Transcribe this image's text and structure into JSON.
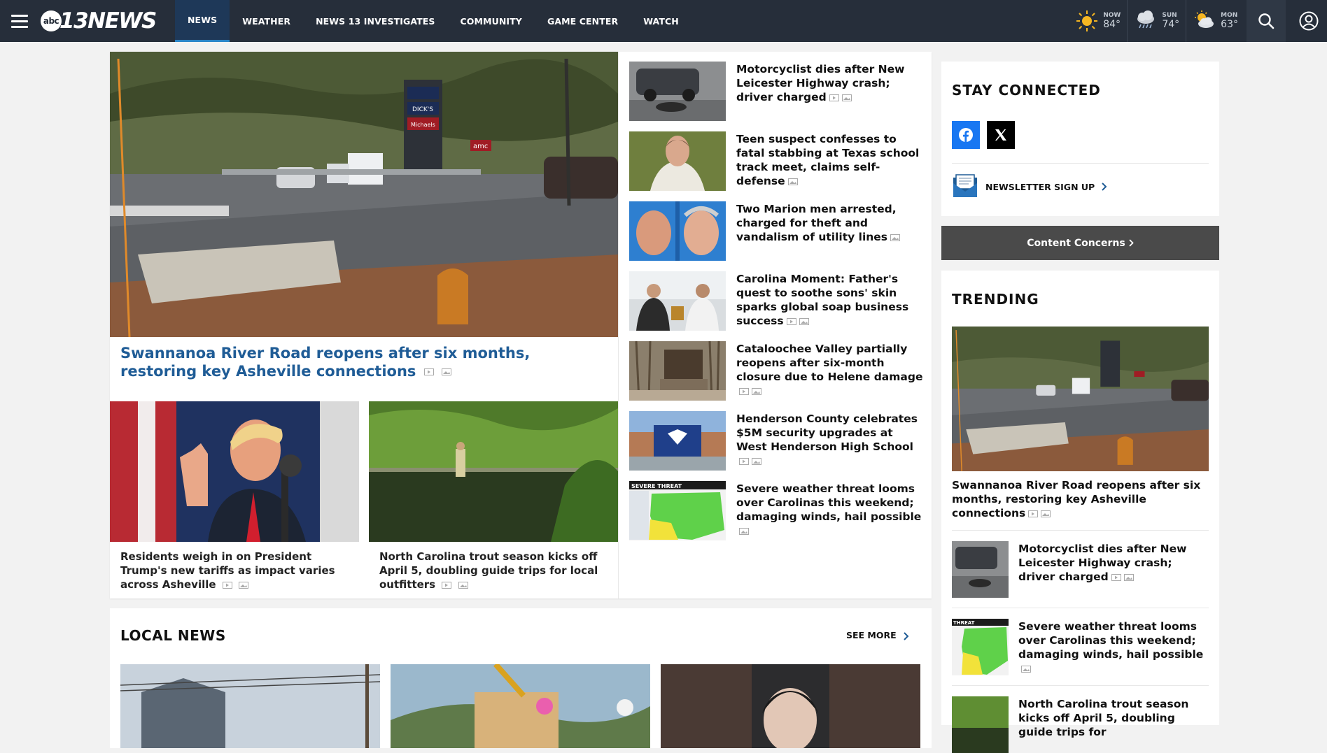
{
  "nav": {
    "brand": "13NEWS",
    "brand_prefix": "abc",
    "links": [
      "NEWS",
      "WEATHER",
      "NEWS 13 INVESTIGATES",
      "COMMUNITY",
      "GAME CENTER",
      "WATCH"
    ],
    "active": "NEWS"
  },
  "weather": [
    {
      "day": "NOW",
      "temp": "84°",
      "icon": "sun-icon"
    },
    {
      "day": "SUN",
      "temp": "74°",
      "icon": "rain-cloud-icon"
    },
    {
      "day": "MON",
      "temp": "63°",
      "icon": "partly-cloudy-icon"
    }
  ],
  "hero": {
    "title": "Swannanoa River Road reopens after six months, restoring key Asheville connections"
  },
  "sub_stories": [
    {
      "title": "Residents weigh in on President Trump's new tariffs as impact varies across Asheville"
    },
    {
      "title": "North Carolina trout season kicks off April 5, doubling guide trips for local outfitters"
    }
  ],
  "headlines": [
    {
      "title": "Motorcyclist dies after New Leicester Highway crash; driver charged",
      "video": true
    },
    {
      "title": "Teen suspect confesses to fatal stabbing at Texas school track meet, claims self-defense",
      "video": false
    },
    {
      "title": "Two Marion men arrested, charged for theft and vandalism of utility lines",
      "video": false
    },
    {
      "title": "Carolina Moment: Father's quest to soothe sons' skin sparks global soap business success",
      "video": true
    },
    {
      "title": "Cataloochee Valley partially reopens after six-month closure due to Helene damage",
      "video": true
    },
    {
      "title": "Henderson County celebrates $5M security upgrades at West Henderson High School",
      "video": true
    },
    {
      "title": "Severe weather threat looms over Carolinas this weekend; damaging winds, hail possible",
      "video": false
    }
  ],
  "thumb_text": {
    "severe": "SEVERE THREAT",
    "threat": "THREAT",
    "amc": "amc",
    "store1": "DICK'S",
    "store2": "Michaels"
  },
  "local": {
    "heading": "LOCAL NEWS",
    "see_more": "SEE MORE"
  },
  "stay_connected": {
    "heading": "STAY CONNECTED",
    "newsletter": "NEWSLETTER SIGN UP"
  },
  "content_concerns": "Content Concerns",
  "trending": {
    "heading": "TRENDING",
    "hero_caption": "Swannanoa River Road reopens after six months, restoring key Asheville connections",
    "items": [
      {
        "title": "Motorcyclist dies after New Leicester Highway crash; driver charged"
      },
      {
        "title": "Severe weather threat looms over Carolinas this weekend; damaging winds, hail possible"
      },
      {
        "title": "North Carolina trout season kicks off April 5, doubling guide trips for"
      }
    ]
  },
  "colors": {
    "nav_bg": "#262e3a",
    "accent_blue": "#1f5c96",
    "facebook": "#1877f2",
    "x": "#000000"
  }
}
